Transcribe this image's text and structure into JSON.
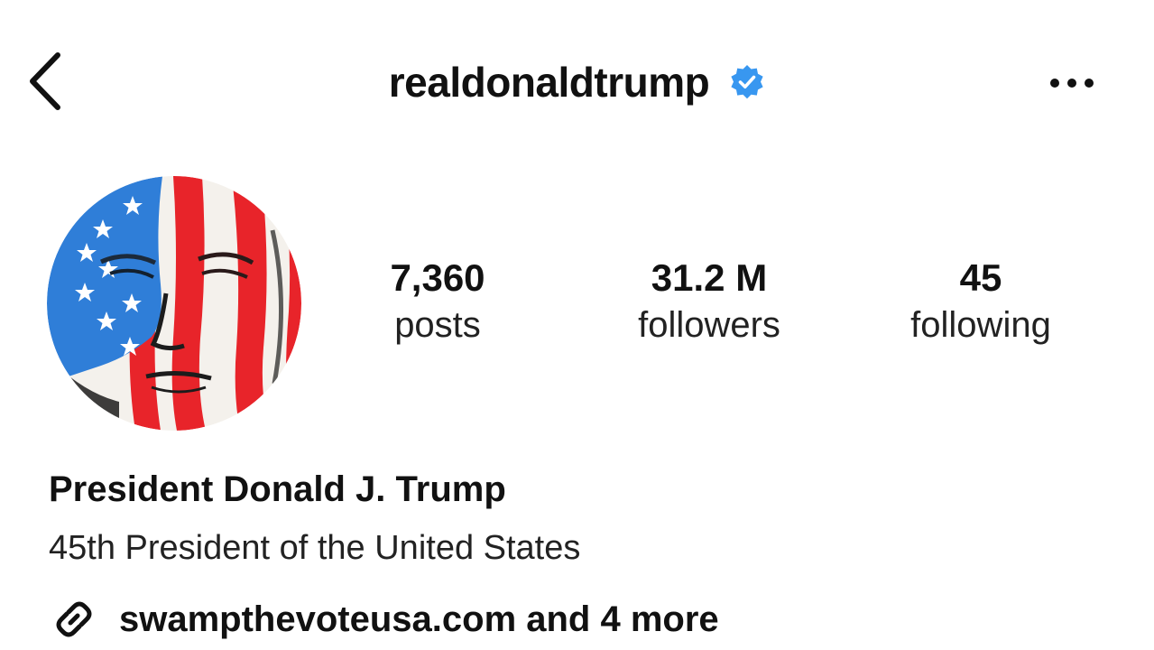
{
  "header": {
    "username": "realdonaldtrump",
    "verified": true,
    "back_icon": "chevron-left-icon",
    "verified_icon": "verified-badge-icon",
    "more_icon": "more-horizontal-icon",
    "verified_color": "#3897f0"
  },
  "profile": {
    "avatar": "american-flag-portrait",
    "stats": [
      {
        "value": "7,360",
        "label": "posts"
      },
      {
        "value": "31.2 M",
        "label": "followers"
      },
      {
        "value": "45",
        "label": "following"
      }
    ],
    "full_name": "President Donald J. Trump",
    "bio": "45th President of the United States",
    "link": {
      "icon": "link-icon",
      "text": "swampthevoteusa.com and 4 more"
    }
  },
  "colors": {
    "flag_red": "#e8242a",
    "flag_blue": "#2f7ed8",
    "text": "#111111"
  }
}
